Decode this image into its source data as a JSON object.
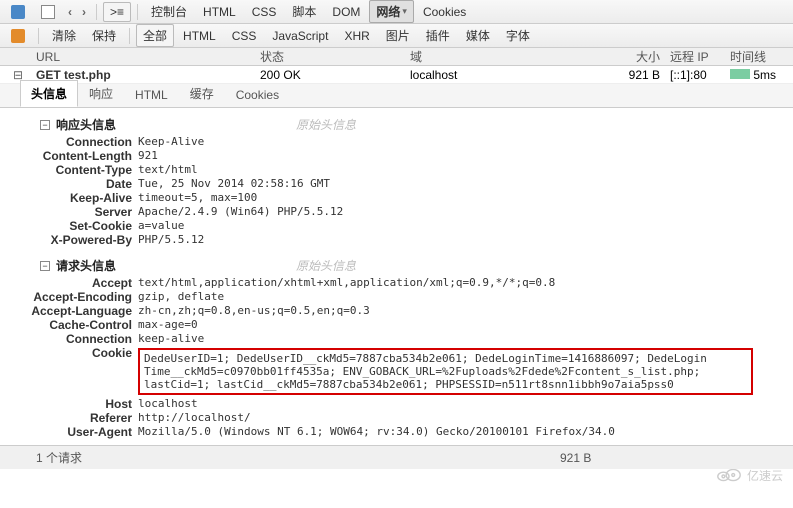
{
  "toolbar1": {
    "items": [
      "控制台",
      "HTML",
      "CSS",
      "脚本",
      "DOM",
      "网络",
      "Cookies"
    ],
    "active": "网络"
  },
  "toolbar2": {
    "clear": "清除",
    "keep": "保持",
    "all": "全部",
    "items": [
      "HTML",
      "CSS",
      "JavaScript",
      "XHR",
      "图片",
      "插件",
      "媒体",
      "字体"
    ]
  },
  "columns": {
    "url": "URL",
    "status": "状态",
    "domain": "域",
    "size": "大小",
    "remote_ip": "远程 IP",
    "timeline": "时间线"
  },
  "request": {
    "method_url": "GET test.php",
    "status": "200 OK",
    "domain": "localhost",
    "size": "921 B",
    "remote_ip": "[::1]:80",
    "time": "5ms"
  },
  "tabs": {
    "items": [
      "头信息",
      "响应",
      "HTML",
      "缓存",
      "Cookies"
    ],
    "active": "头信息"
  },
  "sections": {
    "resp": {
      "title": "响应头信息",
      "raw": "原始头信息"
    },
    "req": {
      "title": "请求头信息",
      "raw": "原始头信息"
    }
  },
  "response_headers": {
    "Connection": "Keep-Alive",
    "Content-Length": "921",
    "Content-Type": "text/html",
    "Date": "Tue, 25 Nov 2014 02:58:16 GMT",
    "Keep-Alive": "timeout=5, max=100",
    "Server": "Apache/2.4.9 (Win64) PHP/5.5.12",
    "Set-Cookie": "a=value",
    "X-Powered-By": "PHP/5.5.12"
  },
  "request_headers": {
    "Accept": "text/html,application/xhtml+xml,application/xml;q=0.9,*/*;q=0.8",
    "Accept-Encoding": "gzip, deflate",
    "Accept-Language": "zh-cn,zh;q=0.8,en-us;q=0.5,en;q=0.3",
    "Cache-Control": "max-age=0",
    "Connection": "keep-alive",
    "Cookie": "DedeUserID=1; DedeUserID__ckMd5=7887cba534b2e061; DedeLoginTime=1416886097; DedeLoginTime__ckMd5=c0970bb01ff4535a; ENV_GOBACK_URL=%2Fuploads%2Fdede%2Fcontent_s_list.php; lastCid=1; lastCid__ckMd5=7887cba534b2e061; PHPSESSID=n511rt8snn1ibbh9o7aia5pss0",
    "Host": "localhost",
    "Referer": "http://localhost/",
    "User-Agent": "Mozilla/5.0 (Windows NT 6.1; WOW64; rv:34.0) Gecko/20100101 Firefox/34.0"
  },
  "footer": {
    "count": "1 个请求",
    "total": "921 B"
  },
  "watermark": "亿速云"
}
